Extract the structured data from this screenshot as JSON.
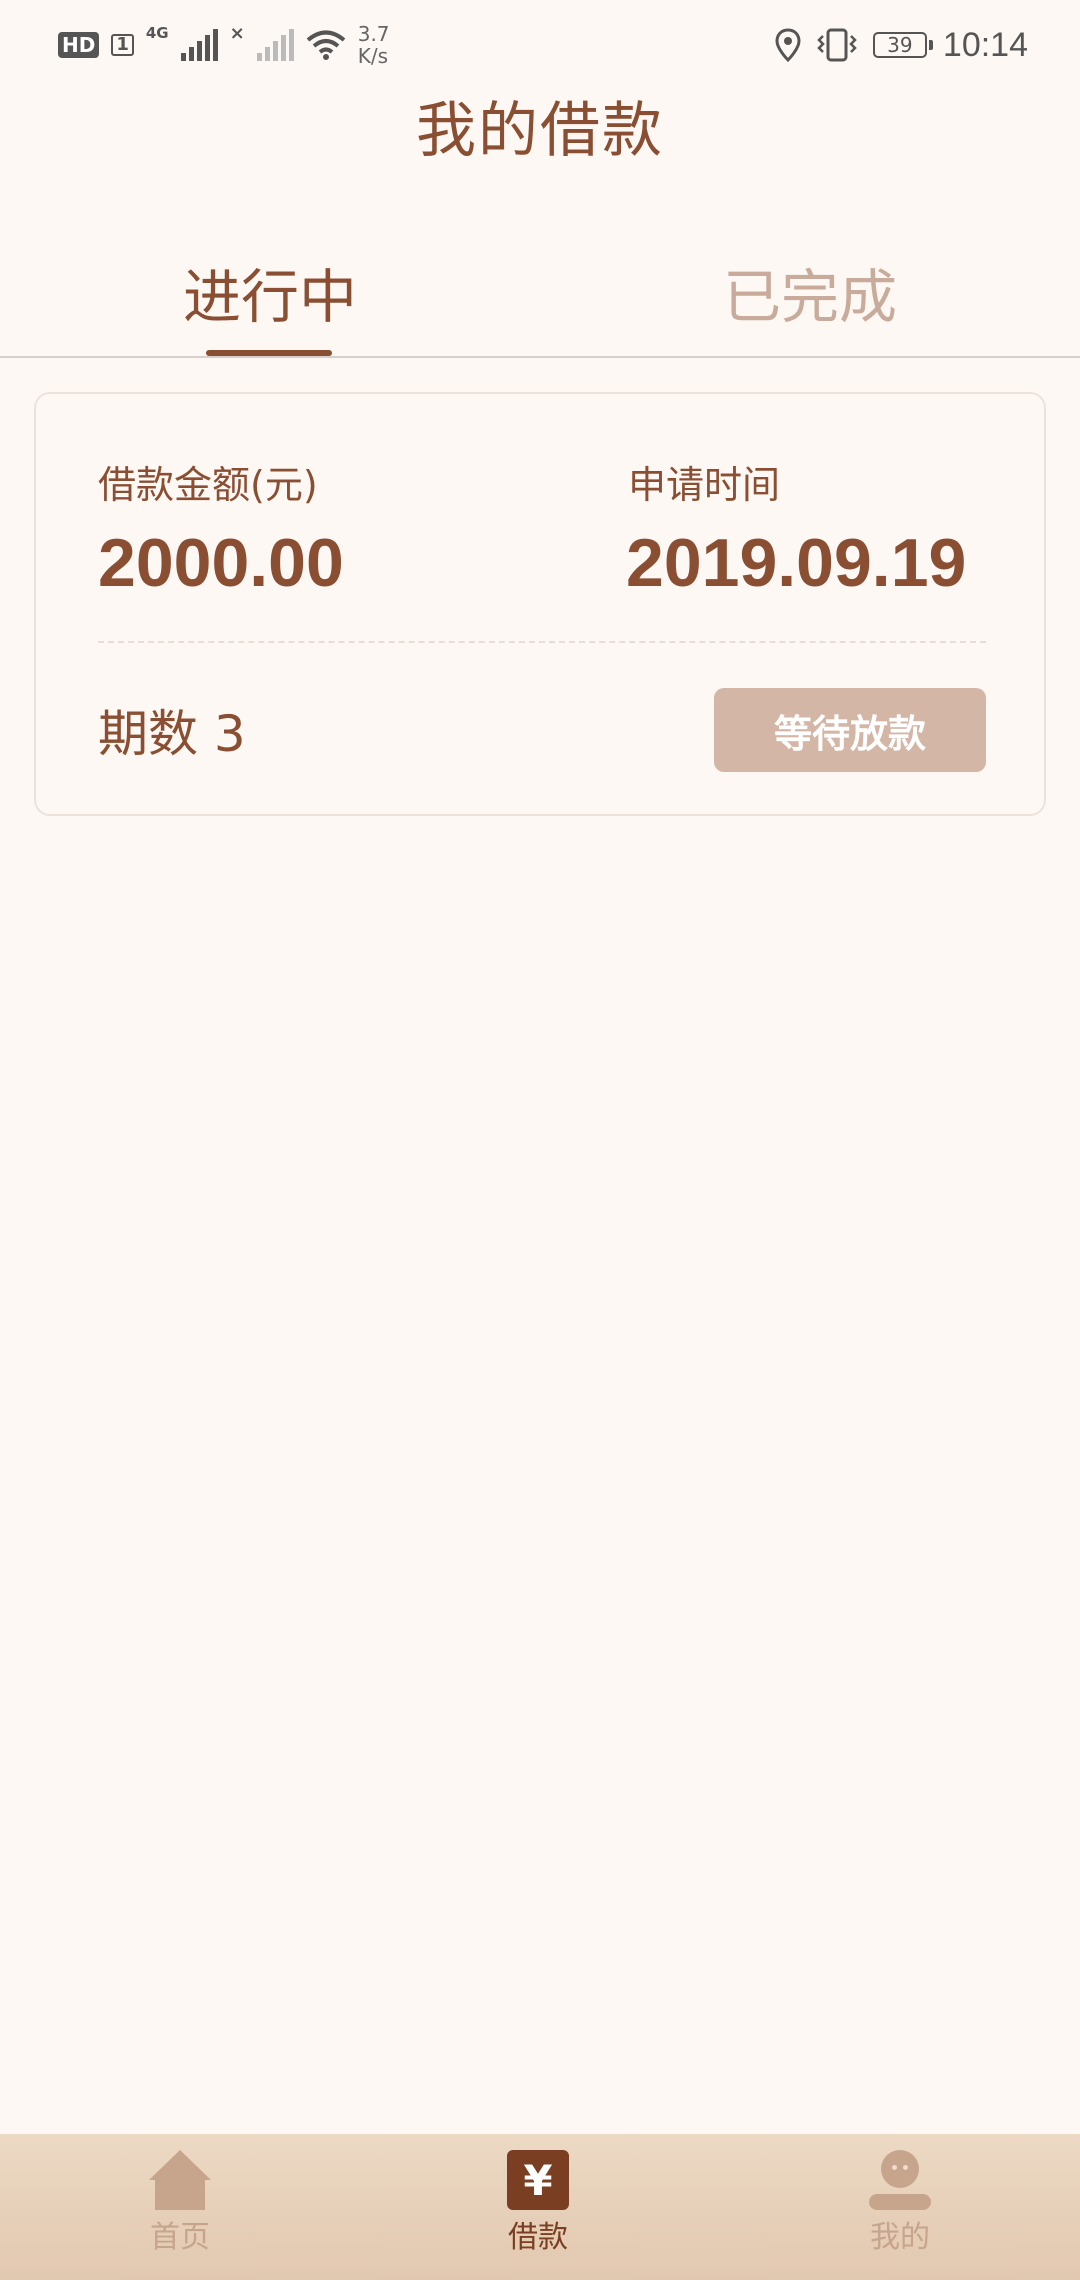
{
  "status_bar": {
    "hd": "HD",
    "sim": "1",
    "network": "4G",
    "speed_value": "3.7",
    "speed_unit": "K/s",
    "battery": "39",
    "time": "10:14"
  },
  "header": {
    "title": "我的借款"
  },
  "tabs": [
    {
      "label": "进行中",
      "active": true
    },
    {
      "label": "已完成",
      "active": false
    }
  ],
  "loan_card": {
    "amount_label": "借款金额(元)",
    "amount_value": "2000.00",
    "date_label": "申请时间",
    "date_value": "2019.09.19",
    "periods_label": "期数",
    "periods_value": "3",
    "status_button": "等待放款"
  },
  "bottom_nav": [
    {
      "label": "首页",
      "icon": "home-icon",
      "active": false
    },
    {
      "label": "借款",
      "icon": "yen-icon",
      "active": true
    },
    {
      "label": "我的",
      "icon": "user-icon",
      "active": false
    }
  ],
  "colors": {
    "primary": "#8a4f33",
    "inactive": "#c8ab9b",
    "background": "#fdf8f4",
    "button": "#d4b6a7",
    "nav_bg": "#e6cfb9"
  }
}
